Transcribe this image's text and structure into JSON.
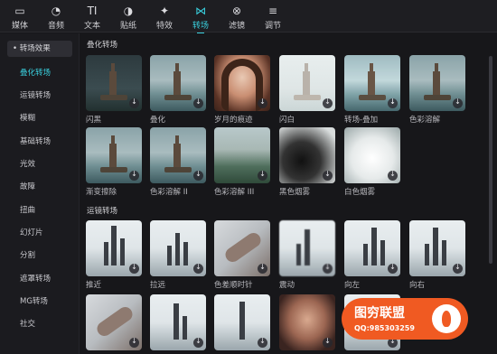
{
  "toolbar": {
    "items": [
      {
        "label": "媒体",
        "icon": "media-icon",
        "glyph": "▭"
      },
      {
        "label": "音频",
        "icon": "audio-icon",
        "glyph": "◔"
      },
      {
        "label": "文本",
        "icon": "text-icon",
        "glyph": "TI"
      },
      {
        "label": "贴纸",
        "icon": "sticker-icon",
        "glyph": "◑"
      },
      {
        "label": "特效",
        "icon": "effects-icon",
        "glyph": "✦"
      },
      {
        "label": "转场",
        "icon": "transition-icon",
        "glyph": "⋈"
      },
      {
        "label": "滤镜",
        "icon": "filter-icon",
        "glyph": "⊗"
      },
      {
        "label": "调节",
        "icon": "adjust-icon",
        "glyph": "≡"
      }
    ],
    "active": "转场",
    "accent": "#3ad0de"
  },
  "sidebar": {
    "group": "• 转场效果",
    "items": [
      "叠化转场",
      "运镜转场",
      "模糊",
      "基础转场",
      "光效",
      "故障",
      "扭曲",
      "幻灯片",
      "分割",
      "遮罩转场",
      "MG转场",
      "社交"
    ],
    "active": "叠化转场"
  },
  "main": {
    "sections": [
      {
        "title": "叠化转场",
        "tiles": [
          {
            "label": "闪黑",
            "art": "dark tower"
          },
          {
            "label": "叠化",
            "art": "tower"
          },
          {
            "label": "岁月的痕迹",
            "art": "portrait"
          },
          {
            "label": "闪白",
            "art": "fade tower"
          },
          {
            "label": "转场-叠加",
            "art": "tower"
          },
          {
            "label": "色彩溶解",
            "art": "tower"
          },
          {
            "label": "渐变擦除",
            "art": "tower"
          },
          {
            "label": "色彩溶解 II",
            "art": "tower"
          },
          {
            "label": "色彩溶解 III",
            "art": "green"
          },
          {
            "label": "黑色烟雾",
            "art": "smoke-black"
          },
          {
            "label": "白色烟雾",
            "art": "smoke-white"
          }
        ]
      },
      {
        "title": "运镜转场",
        "tiles": [
          {
            "label": "推近",
            "art": "city"
          },
          {
            "label": "拉远",
            "art": "city"
          },
          {
            "label": "色差顺时针",
            "art": "hands"
          },
          {
            "label": "震动",
            "art": "city"
          },
          {
            "label": "向左",
            "art": "city"
          },
          {
            "label": "向右",
            "art": "city"
          },
          {
            "label": "",
            "art": "hands"
          },
          {
            "label": "",
            "art": "city"
          },
          {
            "label": "",
            "art": "city"
          },
          {
            "label": "",
            "art": "girl"
          },
          {
            "label": "",
            "art": "city"
          }
        ]
      }
    ]
  },
  "watermark": {
    "line1": "图穷联盟",
    "line2": "QQ:985303259"
  }
}
